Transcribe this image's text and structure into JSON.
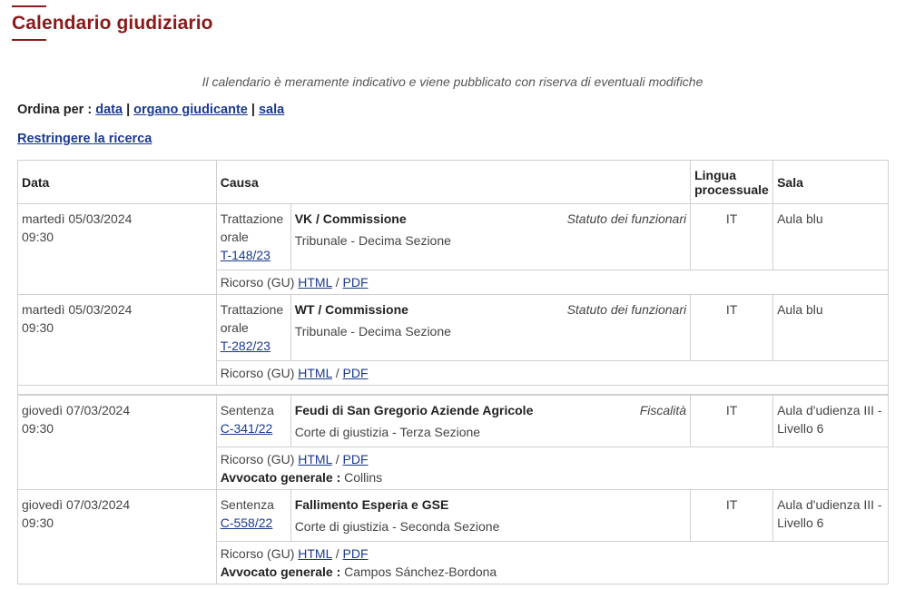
{
  "page": {
    "title": "Calendario giudiziario",
    "notice": "Il calendario è meramente indicativo e viene pubblicato con riserva di eventuali modifiche",
    "sort_label": "Ordina per :",
    "sort_options": [
      "data",
      "organo giudicante",
      "sala"
    ],
    "sort_separator": "|",
    "restrict_label": "Restringere la ricerca"
  },
  "colors": {
    "title": "#8b1a1a",
    "link": "#1a3a8f",
    "border": "#d0d0d0"
  },
  "table": {
    "headers": {
      "date": "Data",
      "cause": "Causa",
      "lang": "Lingua processuale",
      "room": "Sala"
    },
    "doc_prefix": "Ricorso (GU)",
    "html_label": "HTML",
    "pdf_label": "PDF",
    "doc_slash": "/",
    "ag_label": "Avvocato generale :",
    "rows": [
      {
        "date": "martedì 05/03/2024",
        "time": "09:30",
        "type": "Trattazione orale",
        "case_no": "T-148/23",
        "title": "VK / Commissione",
        "subject": "Statuto dei funzionari",
        "court": "Tribunale - Decima Sezione",
        "lang": "IT",
        "room": "Aula blu",
        "ag": ""
      },
      {
        "date": "martedì 05/03/2024",
        "time": "09:30",
        "type": "Trattazione orale",
        "case_no": "T-282/23",
        "title": "WT / Commissione",
        "subject": "Statuto dei funzionari",
        "court": "Tribunale - Decima Sezione",
        "lang": "IT",
        "room": "Aula blu",
        "ag": ""
      },
      {
        "date": "giovedì 07/03/2024",
        "time": "09:30",
        "type": "Sentenza",
        "case_no": "C-341/22",
        "title": "Feudi di San Gregorio Aziende Agricole",
        "subject": "Fiscalità",
        "court": "Corte di giustizia - Terza Sezione",
        "lang": "IT",
        "room": "Aula d'udienza III - Livello 6",
        "ag": "Collins"
      },
      {
        "date": "giovedì 07/03/2024",
        "time": "09:30",
        "type": "Sentenza",
        "case_no": "C-558/22",
        "title": "Fallimento Esperia e GSE",
        "subject": "",
        "court": "Corte di giustizia - Seconda Sezione",
        "lang": "IT",
        "room": "Aula d'udienza III - Livello 6",
        "ag": "Campos Sánchez-Bordona"
      }
    ]
  }
}
